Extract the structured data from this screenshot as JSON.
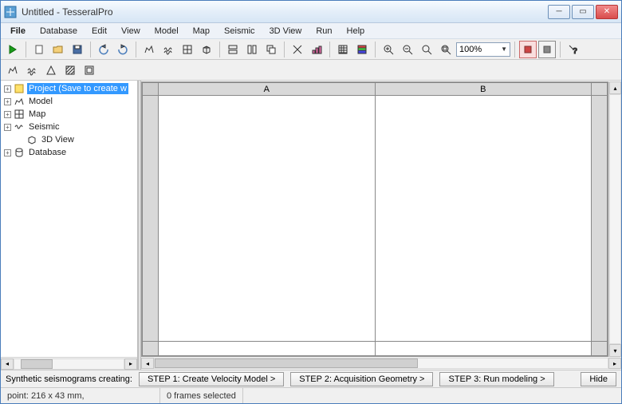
{
  "window": {
    "title": "Untitled - TesseralPro"
  },
  "menu": {
    "items": [
      "File",
      "Database",
      "Edit",
      "View",
      "Model",
      "Map",
      "Seismic",
      "3D View",
      "Run",
      "Help"
    ]
  },
  "toolbar1": {
    "zoom_value": "100%"
  },
  "tree": {
    "items": [
      {
        "label": "Project (Save to create w",
        "selected": true,
        "icon": "project-icon",
        "expand": "+"
      },
      {
        "label": "Model",
        "icon": "model-icon",
        "expand": "+"
      },
      {
        "label": "Map",
        "icon": "map-icon",
        "expand": "+"
      },
      {
        "label": "Seismic",
        "icon": "seismic-icon",
        "expand": "+"
      },
      {
        "label": "3D View",
        "icon": "3dview-icon",
        "expand": "",
        "indent": 1
      },
      {
        "label": "Database",
        "icon": "database-icon",
        "expand": "+"
      }
    ]
  },
  "grid": {
    "columns": [
      "A",
      "B"
    ]
  },
  "steps": {
    "label": "Synthetic seismograms creating:",
    "buttons": [
      "STEP 1: Create Velocity Model >",
      "STEP 2: Acquisition Geometry >",
      "STEP 3: Run modeling >"
    ],
    "hide": "Hide"
  },
  "status": {
    "position": "point: 216 x 43 mm,",
    "selection": "0 frames selected"
  }
}
